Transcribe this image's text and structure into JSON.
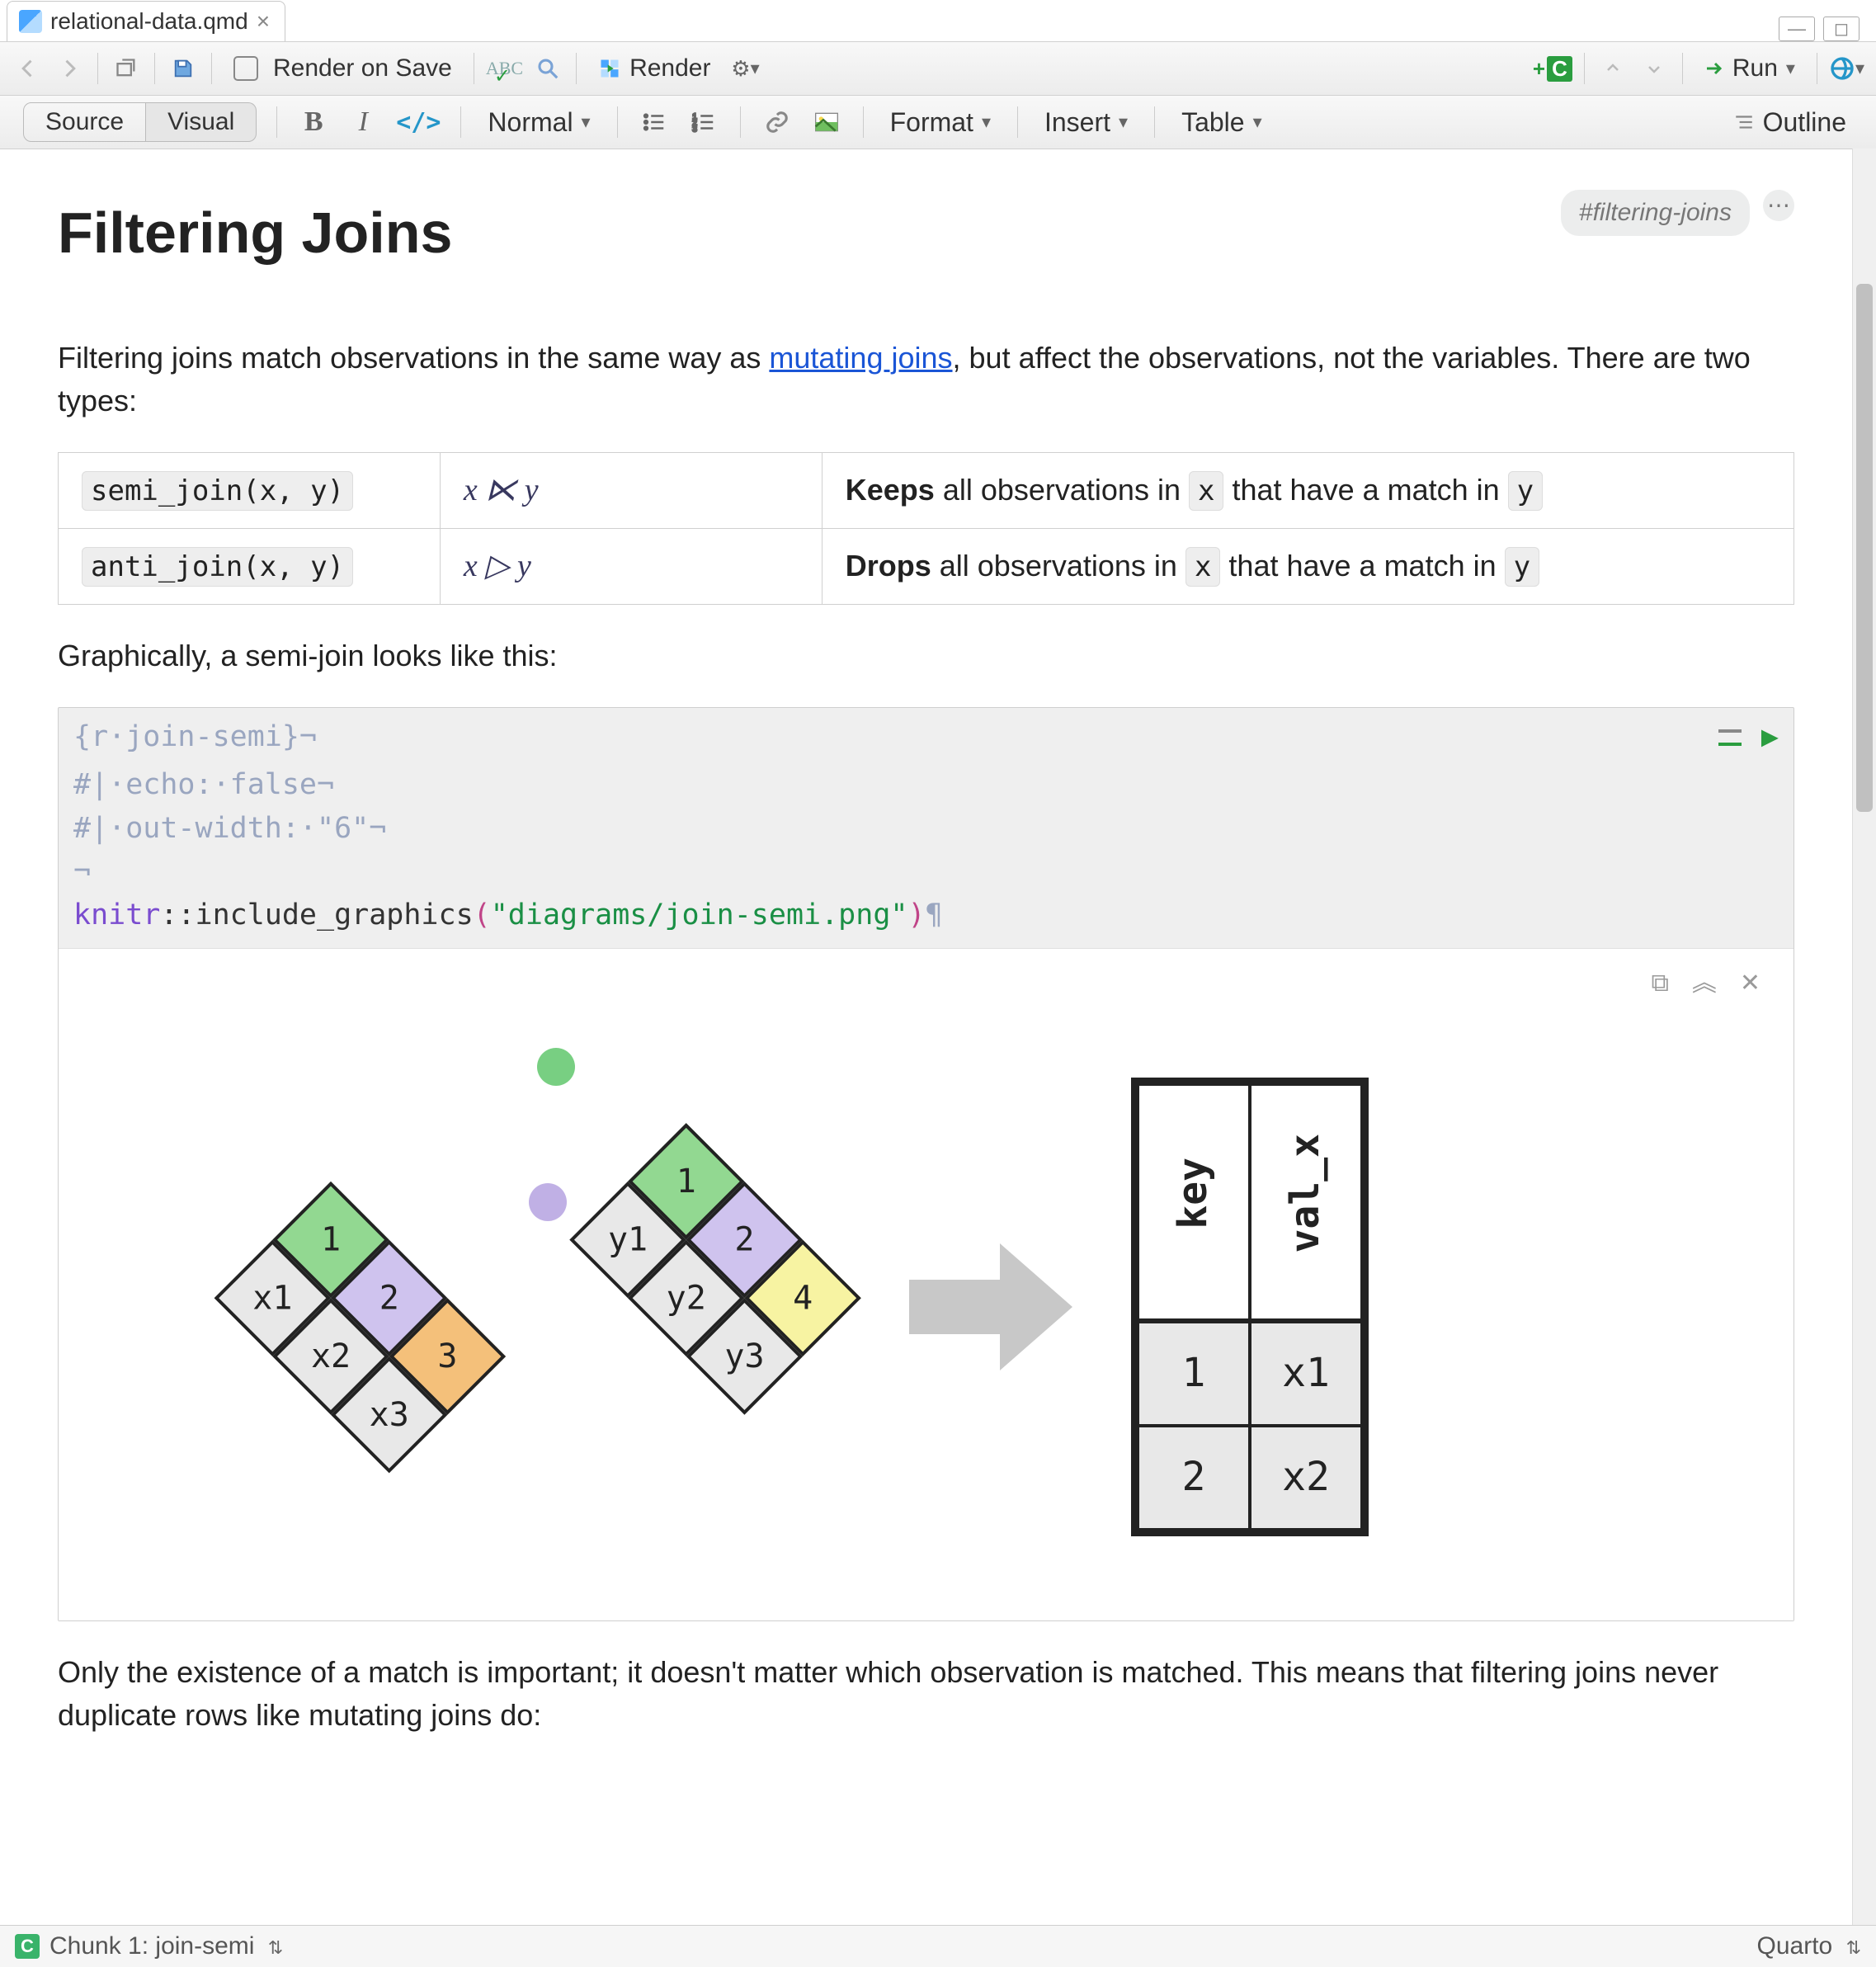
{
  "tab": {
    "filename": "relational-data.qmd"
  },
  "toolbar1": {
    "render_on_save": "Render on Save",
    "render": "Render",
    "run": "Run"
  },
  "toolbar2": {
    "source": "Source",
    "visual": "Visual",
    "normal": "Normal",
    "format": "Format",
    "insert": "Insert",
    "table": "Table",
    "outline": "Outline"
  },
  "doc": {
    "heading": "Filtering Joins",
    "tag": "#filtering-joins",
    "p1a": "Filtering joins match observations in the same way as ",
    "p1link": "mutating joins",
    "p1b": ", but affect the observations, not the variables. There are two types:",
    "table": [
      {
        "fn": "semi_join(x, y)",
        "sym": "x ⋉ y",
        "desc_bold": "Keeps",
        "desc_a": " all observations in ",
        "x": "x",
        "desc_b": " that have a match in ",
        "y": "y"
      },
      {
        "fn": "anti_join(x, y)",
        "sym": "x ▷ y",
        "desc_bold": "Drops",
        "desc_a": " all observations in ",
        "x": "x",
        "desc_b": " that have a match in ",
        "y": "y"
      }
    ],
    "p2": "Graphically, a semi-join looks like this:",
    "p3": "Only the existence of a match is important; it doesn't matter which observation is matched. This means that filtering joins never duplicate rows like mutating joins do:"
  },
  "chunk": {
    "header": "{r·join-semi}¬",
    "c1": "#|·echo:·false¬",
    "c2": "#|·out-width:·\"6\"¬",
    "knitr": "knitr",
    "fn": "::include_graphics",
    "path": "\"diagrams/join-semi.png\"",
    "pil": "¶"
  },
  "diagram": {
    "left": {
      "keys": [
        "1",
        "2",
        "3"
      ],
      "vals": [
        "x1",
        "x2",
        "x3"
      ]
    },
    "right": {
      "keys": [
        "1",
        "2",
        "4"
      ],
      "vals": [
        "y1",
        "y2",
        "y3"
      ]
    },
    "result": {
      "headers": [
        "key",
        "val_x"
      ],
      "rows": [
        {
          "key": "1",
          "val": "x1",
          "cls": "k1"
        },
        {
          "key": "2",
          "val": "x2",
          "cls": "k2"
        }
      ]
    }
  },
  "status": {
    "chunk": "Chunk 1: join-semi",
    "engine": "Quarto"
  }
}
